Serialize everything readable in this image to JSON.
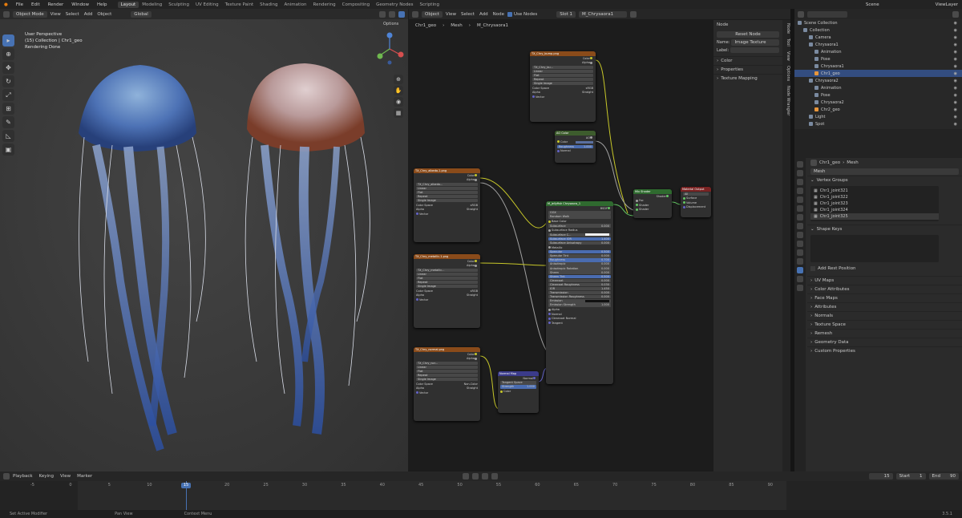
{
  "menu": [
    "File",
    "Edit",
    "Render",
    "Window",
    "Help"
  ],
  "workspaces": [
    "Layout",
    "Modeling",
    "Sculpting",
    "UV Editing",
    "Texture Paint",
    "Shading",
    "Animation",
    "Rendering",
    "Compositing",
    "Geometry Nodes",
    "Scripting"
  ],
  "active_workspace": "Layout",
  "scene": "Scene",
  "view_layer": "ViewLayer",
  "viewport": {
    "mode": "Object Mode",
    "menus": [
      "View",
      "Select",
      "Add",
      "Object"
    ],
    "orientation": "Global",
    "overlay_lines": [
      "User Perspective",
      "(15) Collection | Chr1_geo",
      "Rendering Done"
    ],
    "options_label": "Options"
  },
  "node_editor": {
    "editor_type": "Object",
    "menus": [
      "View",
      "Select",
      "Add",
      "Node"
    ],
    "use_nodes_label": "Use Nodes",
    "slot": "Slot 1",
    "material": "M_Chrysaora1",
    "breadcrumb": [
      "Chr1_geo",
      "Mesh",
      "M_Chrysaora1"
    ],
    "side_tabs": [
      "Node",
      "Tool",
      "View",
      "Options",
      "Node Wrangler"
    ],
    "sidebar": {
      "section": "Node",
      "reset_label": "Reset Node",
      "name_label": "Name:",
      "name_value": "Image Texture",
      "label_label": "Label:",
      "items": [
        "Color",
        "Properties",
        "Texture Mapping"
      ]
    },
    "nodes": {
      "tex_bump": {
        "title": "TX_Chry_bump.png",
        "outs": [
          "Color",
          "Alpha"
        ],
        "image": "TX_Chry_bu...",
        "opts": [
          "Linear",
          "Flat",
          "Repeat",
          "Single Image"
        ],
        "cs_label": "Color Space",
        "cs": "sRGB",
        "alpha_label": "Alpha",
        "alpha": "Straight",
        "vector": "Vector"
      },
      "ao": {
        "title": "AO Color",
        "out": "AO",
        "color": "Color",
        "roughness_label": "Roughness",
        "roughness": "1.000",
        "normal": "Normal"
      },
      "tex_albedo": {
        "title": "TX_Chry_albedo.1.png",
        "outs": [
          "Color",
          "Alpha"
        ],
        "image": "TX_Chry_albedo...",
        "opts": [
          "Linear",
          "Flat",
          "Repeat",
          "Single Image"
        ],
        "cs_label": "Color Space",
        "cs": "sRGB",
        "alpha_label": "Alpha",
        "alpha": "Straight",
        "vector": "Vector"
      },
      "tex_metal": {
        "title": "TX_Chry_metallic.1.png",
        "outs": [
          "Color",
          "Alpha"
        ],
        "image": "TX_Chry_metallic...",
        "opts": [
          "Linear",
          "Flat",
          "Repeat",
          "Single Image"
        ],
        "cs_label": "Color Space",
        "cs": "sRGB",
        "alpha_label": "Alpha",
        "alpha": "Straight",
        "vector": "Vector"
      },
      "tex_normal": {
        "title": "TX_Chry_normal.png",
        "outs": [
          "Color",
          "Alpha"
        ],
        "image": "TX_Chry_nor...",
        "opts": [
          "Linear",
          "Flat",
          "Repeat",
          "Single Image"
        ],
        "cs_label": "Color Space",
        "cs": "Non-Color",
        "alpha_label": "Alpha",
        "alpha": "Straight",
        "vector": "Vector"
      },
      "normal_map": {
        "title": "Normal Map",
        "out": "Normal",
        "space_label": "Tangent Space",
        "strength_label": "Strength",
        "strength": "1.000",
        "color": "Color"
      },
      "bsdf": {
        "title": "M_jellyfish Chrysaora_1",
        "out": "BSDF",
        "dist": "GGX",
        "sss": "Random Walk",
        "rows": [
          {
            "label": "Base Color",
            "value": "",
            "kind": "sock"
          },
          {
            "label": "Subsurface",
            "value": "0.000",
            "kind": "fld"
          },
          {
            "label": "Subsurface Radius",
            "value": "",
            "kind": "sock"
          },
          {
            "label": "Subsurface C...",
            "value": "",
            "kind": "white"
          },
          {
            "label": "Subsurface IOR",
            "value": "1.400",
            "kind": "blue"
          },
          {
            "label": "Subsurface Anisotropy",
            "value": "0.000",
            "kind": "fld"
          },
          {
            "label": "Metallic",
            "value": "",
            "kind": "sock"
          },
          {
            "label": "Specular",
            "value": "0.500",
            "kind": "blue"
          },
          {
            "label": "Specular Tint",
            "value": "0.000",
            "kind": "fld"
          },
          {
            "label": "Roughness",
            "value": "0.700",
            "kind": "blue"
          },
          {
            "label": "Anisotropic",
            "value": "0.000",
            "kind": "fld"
          },
          {
            "label": "Anisotropic Rotation",
            "value": "0.000",
            "kind": "fld"
          },
          {
            "label": "Sheen",
            "value": "0.000",
            "kind": "fld"
          },
          {
            "label": "Sheen Tint",
            "value": "0.500",
            "kind": "blue"
          },
          {
            "label": "Clearcoat",
            "value": "0.000",
            "kind": "fld"
          },
          {
            "label": "Clearcoat Roughness",
            "value": "0.030",
            "kind": "fld"
          },
          {
            "label": "IOR",
            "value": "1.450",
            "kind": "fld"
          },
          {
            "label": "Transmission",
            "value": "0.000",
            "kind": "fld"
          },
          {
            "label": "Transmission Roughness",
            "value": "0.000",
            "kind": "fld"
          },
          {
            "label": "Emission",
            "value": "",
            "kind": "black"
          },
          {
            "label": "Emission Strength",
            "value": "1.000",
            "kind": "fld"
          },
          {
            "label": "Alpha",
            "value": "",
            "kind": "sock"
          },
          {
            "label": "Normal",
            "value": "",
            "kind": "sock"
          },
          {
            "label": "Clearcoat Normal",
            "value": "",
            "kind": "sock"
          },
          {
            "label": "Tangent",
            "value": "",
            "kind": "sock"
          }
        ]
      },
      "mix": {
        "title": "Mix Shader",
        "out": "Shader",
        "ins": [
          "Fac",
          "Shader",
          "Shader"
        ]
      },
      "output": {
        "title": "Material Output",
        "target": "All",
        "ins": [
          "Surface",
          "Volume",
          "Displacement"
        ]
      }
    }
  },
  "outliner": {
    "items": [
      {
        "label": "Scene Collection",
        "indent": 0,
        "sel": false
      },
      {
        "label": "Collection",
        "indent": 1,
        "sel": false
      },
      {
        "label": "Camera",
        "indent": 2,
        "sel": false
      },
      {
        "label": "Chrysaora1",
        "indent": 2,
        "sel": false
      },
      {
        "label": "Animation",
        "indent": 3,
        "sel": false
      },
      {
        "label": "Pose",
        "indent": 3,
        "sel": false
      },
      {
        "label": "Chrysaora1",
        "indent": 3,
        "sel": false
      },
      {
        "label": "Chr1_geo",
        "indent": 3,
        "sel": true
      },
      {
        "label": "Chrysaora2",
        "indent": 2,
        "sel": false
      },
      {
        "label": "Animation",
        "indent": 3,
        "sel": false
      },
      {
        "label": "Pose",
        "indent": 3,
        "sel": false
      },
      {
        "label": "Chrysaora2",
        "indent": 3,
        "sel": false
      },
      {
        "label": "Chr2_geo",
        "indent": 3,
        "sel": false
      },
      {
        "label": "Light",
        "indent": 2,
        "sel": false
      },
      {
        "label": "Spot",
        "indent": 2,
        "sel": false
      }
    ]
  },
  "properties": {
    "object": "Chr1_geo",
    "data": "Mesh",
    "mesh_name": "Mesh",
    "vertex_groups_label": "Vertex Groups",
    "vertex_groups": [
      "Chr1_joint321",
      "Chr1_joint322",
      "Chr1_joint323",
      "Chr1_joint324",
      "Chr1_joint325"
    ],
    "shape_keys_label": "Shape Keys",
    "add_rest_label": "Add Rest Position",
    "panels": [
      "UV Maps",
      "Color Attributes",
      "Face Maps",
      "Attributes",
      "Normals",
      "Texture Space",
      "Remesh",
      "Geometry Data",
      "Custom Properties"
    ]
  },
  "timeline": {
    "menus": [
      "Playback",
      "Keying",
      "View",
      "Marker"
    ],
    "current_frame": "15",
    "start_label": "Start",
    "start": "1",
    "end_label": "End",
    "end": "90",
    "ticks": [
      "-5",
      "0",
      "5",
      "10",
      "15",
      "20",
      "25",
      "30",
      "35",
      "40",
      "45",
      "50",
      "55",
      "60",
      "65",
      "70",
      "75",
      "80",
      "85",
      "90"
    ]
  },
  "status": {
    "items": [
      "Set Active Modifier",
      "Pan View",
      "Context Menu"
    ],
    "version": "3.5.1"
  },
  "colors": {
    "accent": "#4772b3",
    "texture_header": "#8a4b1a",
    "shader_header": "#2f6a2f",
    "output_header": "#7a2323"
  }
}
